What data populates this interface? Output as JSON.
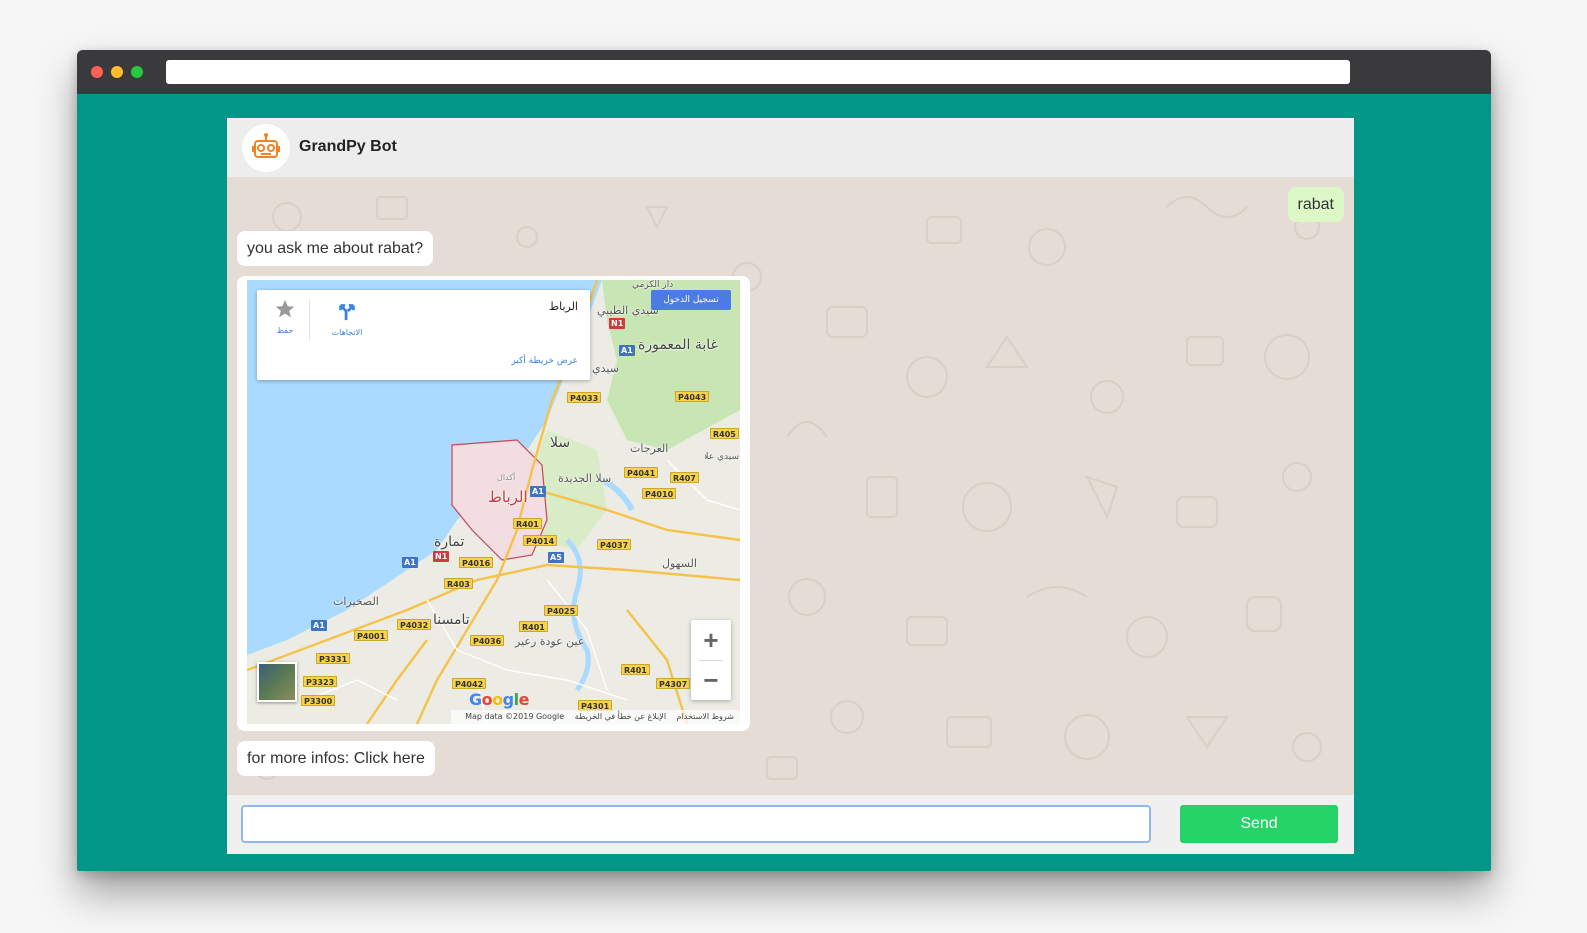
{
  "browser": {
    "url": ""
  },
  "chat": {
    "bot_name": "GrandPy Bot",
    "avatar_icon": "robot-icon",
    "accent_color": "#009688",
    "send_color": "#25d366",
    "user_bubble_color": "#dcf8c6"
  },
  "messages": {
    "user_query": "rabat",
    "bot_question": "you ask me about rabat?",
    "bot_link_prefix": "for more infos: ",
    "bot_link_text": "Click here"
  },
  "map": {
    "place_name": "الرباط",
    "directions_label": "الاتجاهات",
    "save_label": "حفظ",
    "larger_map_link": "عرض خريطة أكبر",
    "sign_in_label": "تسجيل الدخول",
    "zoom_in": "+",
    "zoom_out": "−",
    "google_logo": "Google",
    "attribution": "Map data ©2019 Google",
    "terms": "شروط الاستخدام",
    "report": "الإبلاغ عن خطأ في الخريطة",
    "labels": {
      "sale": "سلا",
      "rabat": "الرباط",
      "temara": "تمارة",
      "tamesna": "تامسنا",
      "sale_jadida": "سلا الجديدة",
      "maamora": "غابة المعمورة",
      "sidi_taibi": "سيدي الطيبي",
      "sidi": "سيدي",
      "arjat": "العرجات",
      "shoul": "السهول",
      "sehrine": "الصخيرات",
      "ain_aouda": "عين عودة رعير",
      "agdal": "أكدال",
      "dar_kasri": "دار الكرمي",
      "sidi_allal": "سيدي علال البحراوي"
    },
    "roads": [
      "N1",
      "A1",
      "P4033",
      "P4043",
      "R405",
      "P4041",
      "R407",
      "A1",
      "P4010",
      "R401",
      "P4014",
      "A5",
      "P4037",
      "N1",
      "A1",
      "P4016",
      "R403",
      "P4025",
      "A1",
      "P4032",
      "R401",
      "P4001",
      "P4036",
      "R401",
      "P3331",
      "P4307",
      "P3323",
      "P4042",
      "P3300",
      "P4301"
    ]
  },
  "composer": {
    "input_value": "",
    "input_placeholder": "",
    "send_label": "Send"
  }
}
